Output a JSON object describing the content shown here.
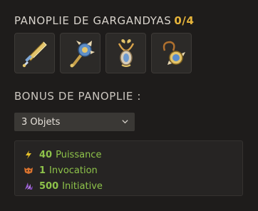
{
  "panoplie": {
    "title": "PANOPLIE DE GARGANDYAS",
    "count": "0/4",
    "items": [
      {
        "icon": "dagger-icon"
      },
      {
        "icon": "hammer-icon"
      },
      {
        "icon": "amulet-icon"
      },
      {
        "icon": "ring-icon"
      }
    ]
  },
  "bonus": {
    "title": "BONUS DE PANOPLIE :",
    "select_value": "3 Objets",
    "stats": [
      {
        "icon": "power-bolt-icon",
        "value": "40",
        "label": "Puissance",
        "color": "#e8c22a"
      },
      {
        "icon": "invocation-icon",
        "value": "1",
        "label": "Invocation",
        "color": "#d8722e"
      },
      {
        "icon": "initiative-icon",
        "value": "500",
        "label": "Initiative",
        "color": "#9b5fd3"
      }
    ]
  },
  "colors": {
    "accent": "#e6b43a",
    "stat_text": "#8ec34a",
    "background": "#1e1c1b"
  }
}
